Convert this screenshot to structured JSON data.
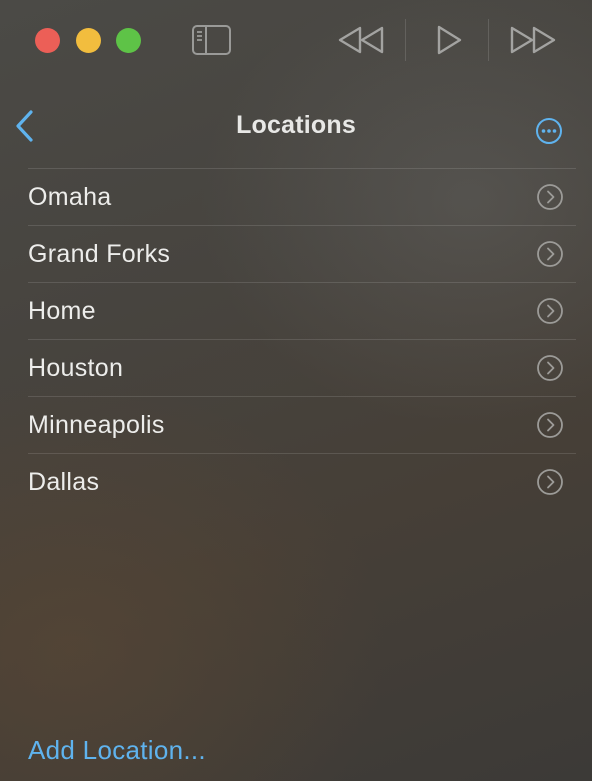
{
  "window": {
    "controls": [
      "close",
      "minimize",
      "zoom"
    ],
    "toolbar_icons": [
      "sidebar-icon",
      "rewind-icon",
      "play-icon",
      "fast-forward-icon"
    ]
  },
  "nav": {
    "title": "Locations",
    "back_icon": "chevron-left-icon",
    "more_icon": "ellipsis-circle-icon"
  },
  "locations": [
    {
      "name": "Omaha"
    },
    {
      "name": "Grand Forks"
    },
    {
      "name": "Home"
    },
    {
      "name": "Houston"
    },
    {
      "name": "Minneapolis"
    },
    {
      "name": "Dallas"
    }
  ],
  "footer": {
    "add_label": "Add Location..."
  },
  "colors": {
    "accent": "#5fb3ee",
    "text": "#ededeb",
    "close": "#ec5f57",
    "minimize": "#f2bd3e",
    "zoom": "#5ec347"
  }
}
